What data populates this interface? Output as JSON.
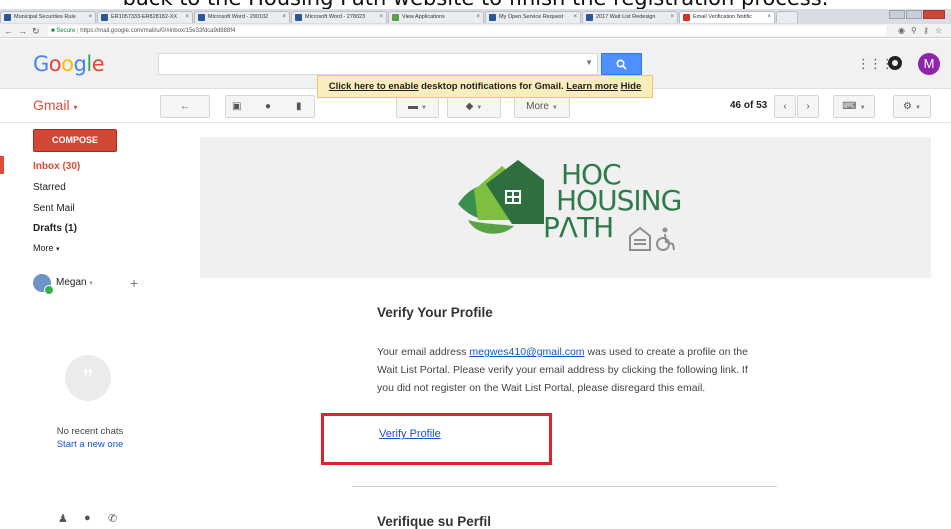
{
  "caption": "back to the Housing Path website to finish the registration process.",
  "browser": {
    "tabs": [
      {
        "label": "Municipal Securities Rule",
        "icon": "blue"
      },
      {
        "label": "ER1057333-ER828182-XX",
        "icon": "blue"
      },
      {
        "label": "Microsoft Word - 290102",
        "icon": "blue"
      },
      {
        "label": "Microsoft Word - 278023",
        "icon": "blue"
      },
      {
        "label": "View Applications",
        "icon": "green"
      },
      {
        "label": "My Open Service Request",
        "icon": "blue"
      },
      {
        "label": "2017 Wait List Redesign",
        "icon": "blue"
      },
      {
        "label": "Email Verification Notific",
        "icon": "gmail"
      }
    ],
    "secure_label": "Secure",
    "url": "https://mail.google.com/mail/u/0/#inbox/15e33fdca9d888f4"
  },
  "gmail": {
    "logo": "Google",
    "brand": "Gmail",
    "avatar_letter": "M",
    "banner": {
      "link_text": "Click here to enable",
      "text": "desktop notifications for Gmail.",
      "learn_more": "Learn more",
      "hide": "Hide"
    },
    "toolbar": {
      "more_label": "More",
      "pager": "46 of 53"
    },
    "compose": "COMPOSE",
    "nav": {
      "inbox": "Inbox (30)",
      "starred": "Starred",
      "sent": "Sent Mail",
      "drafts": "Drafts (1)",
      "more": "More"
    },
    "user": "Megan",
    "chat": {
      "no_recent": "No recent chats",
      "start_new": "Start a new one"
    }
  },
  "email": {
    "logo_lines": [
      "HOC",
      "HOUSING",
      "PΛTH"
    ],
    "title": "Verify Your Profile",
    "body_pre": "Your email address",
    "email_address": "megwes410@gmail.com",
    "body_post": "was used to create a profile on the Wait List Portal. Please verify your email address by clicking the following link. If you did not register on the Wait List Portal, please disregard this email.",
    "verify_link": "Verify Profile",
    "spanish_title": "Verifique su Perfil"
  }
}
